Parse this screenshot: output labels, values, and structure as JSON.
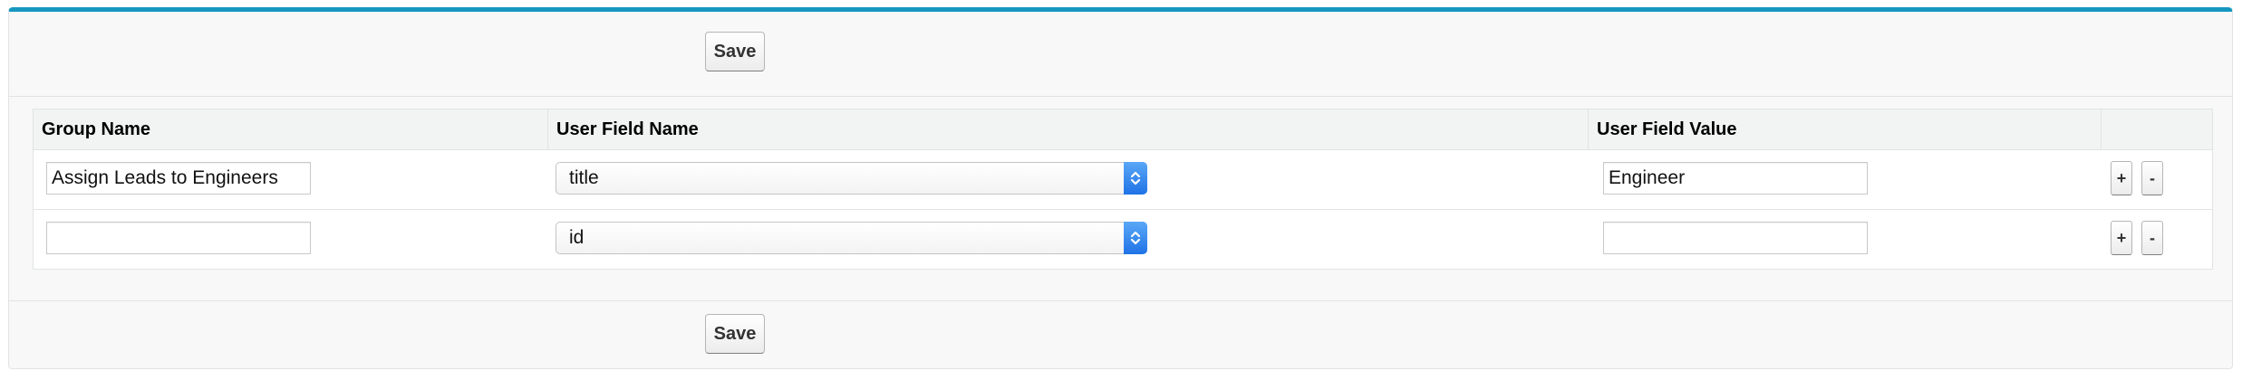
{
  "toolbar": {
    "save_label": "Save"
  },
  "table": {
    "columns": [
      "Group Name",
      "User Field Name",
      "User Field Value",
      ""
    ],
    "rows": [
      {
        "group_name": "Assign Leads to Engineers",
        "user_field_name": "title",
        "user_field_value": "Engineer",
        "add_label": "+",
        "remove_label": "-"
      },
      {
        "group_name": "",
        "user_field_name": "id",
        "user_field_value": "",
        "add_label": "+",
        "remove_label": "-"
      }
    ]
  },
  "colors": {
    "accent_top_border": "#1797c0",
    "select_arrow": "#2a7fe9",
    "panel_background": "#f8f8f8",
    "header_background": "#f2f3f3"
  },
  "icons": {
    "select_arrow": "up-down-chevron-icon"
  }
}
